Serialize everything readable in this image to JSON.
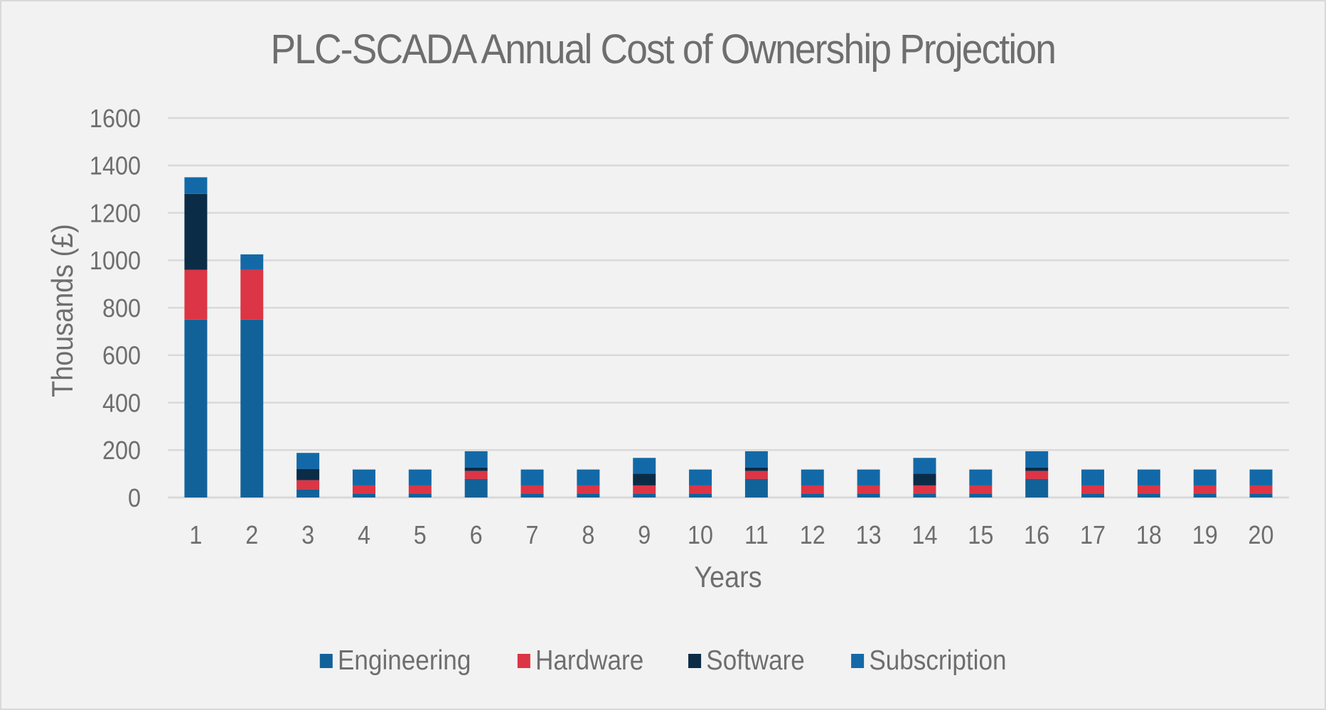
{
  "chart_data": {
    "type": "bar",
    "stacked": true,
    "title": "PLC-SCADA Annual Cost of Ownership Projection",
    "xlabel": "Years",
    "ylabel": "Thousands (£)",
    "ylim": [
      0,
      1600
    ],
    "yticks": [
      0,
      200,
      400,
      600,
      800,
      1000,
      1200,
      1400,
      1600
    ],
    "grid": true,
    "legend_position": "bottom",
    "categories": [
      "1",
      "2",
      "3",
      "4",
      "5",
      "6",
      "7",
      "8",
      "9",
      "10",
      "11",
      "12",
      "13",
      "14",
      "15",
      "16",
      "17",
      "18",
      "19",
      "20"
    ],
    "series": [
      {
        "name": "Engineering",
        "color": "#12629a",
        "values": [
          750,
          750,
          35,
          17,
          17,
          78,
          17,
          17,
          17,
          17,
          78,
          17,
          17,
          17,
          17,
          78,
          17,
          17,
          17,
          17
        ]
      },
      {
        "name": "Hardware",
        "color": "#dc3545",
        "values": [
          210,
          210,
          38,
          34,
          34,
          34,
          34,
          34,
          34,
          34,
          34,
          34,
          34,
          34,
          34,
          34,
          34,
          34,
          34,
          34
        ]
      },
      {
        "name": "Software",
        "color": "#0b2c47",
        "values": [
          320,
          0,
          47,
          0,
          0,
          14,
          0,
          0,
          50,
          0,
          14,
          0,
          0,
          50,
          0,
          14,
          0,
          0,
          0,
          0
        ]
      },
      {
        "name": "Subscription",
        "color": "#1369a7",
        "values": [
          70,
          65,
          68,
          67,
          67,
          69,
          67,
          67,
          66,
          67,
          69,
          67,
          67,
          66,
          67,
          69,
          67,
          67,
          67,
          67
        ]
      }
    ]
  }
}
